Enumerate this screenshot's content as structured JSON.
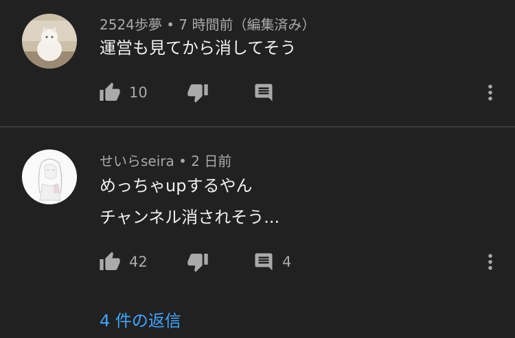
{
  "comments": [
    {
      "author": "2524歩夢",
      "time": "7 時間前（編集済み）",
      "lines": [
        "運営も見てから消してそう"
      ],
      "likes": "10",
      "replies": ""
    },
    {
      "author": "せいらseira",
      "time": "2 日前",
      "lines": [
        "めっちゃupするやん",
        "チャンネル消されそう..."
      ],
      "likes": "42",
      "replies": "4"
    }
  ],
  "separator": " • ",
  "view_replies_label": "4 件の返信",
  "icons": {
    "like": "thumb-up-icon",
    "dislike": "thumb-down-icon",
    "reply": "comment-icon",
    "menu": "more-vert-icon"
  },
  "colors": {
    "background": "#212121",
    "link": "#3ea6ff",
    "secondary_text": "#aaaaaa",
    "primary_text": "#f1f1f1"
  }
}
